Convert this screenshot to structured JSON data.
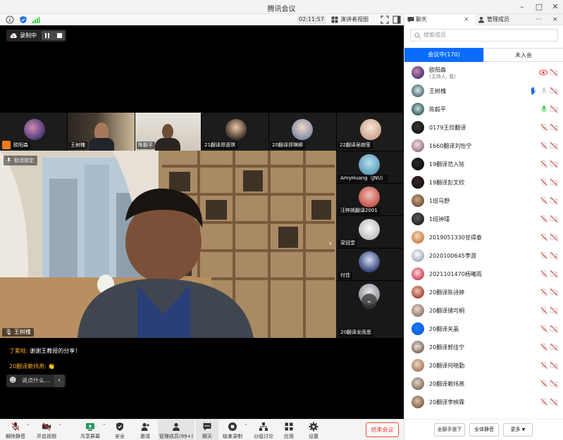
{
  "window": {
    "title": "腾讯会议"
  },
  "toolbar": {
    "timer": "02:11:57",
    "view_label": "演讲者视图"
  },
  "recording": {
    "label": "录制中"
  },
  "thumbs": [
    {
      "name": "欧阳森"
    },
    {
      "name": "王树槐"
    },
    {
      "name": "陈毅平"
    },
    {
      "name": "21翻译郑语琪"
    },
    {
      "name": "20翻译郑琳卿"
    },
    {
      "name": "22翻译吴婉莹"
    }
  ],
  "vthumbs": [
    {
      "name": "AmyHuang（JNU）"
    },
    {
      "name": "汪梓嫣翻译2001"
    },
    {
      "name": "梁冠堂"
    },
    {
      "name": "付佳"
    },
    {
      "name": "20翻译龙雨思"
    }
  ],
  "main_video": {
    "pin_label": "取消锁定",
    "speaker": "王树槐"
  },
  "chat": {
    "msg1": {
      "sender": "丁紫晗:",
      "text": "谢谢王教授的分享！"
    },
    "msg2": {
      "sender": "20翻译赖炜燕:",
      "emoji": "👏"
    },
    "placeholder": "说点什么..."
  },
  "bottom": {
    "unmute": "解除静音",
    "video": "开启视频",
    "share": "共享屏幕",
    "security": "安全",
    "invite": "邀请",
    "members": "管理成员(99+)",
    "chat": "聊天",
    "end_record": "结束录制",
    "breakout": "分组讨论",
    "apps": "应用",
    "settings": "设置",
    "end_meeting": "结束会议"
  },
  "panel": {
    "tab_chat": "聊天",
    "tab_members": "管理成员",
    "search_placeholder": "搜索成员",
    "seg_in": "会议中(170)",
    "seg_not": "未入会",
    "members": [
      {
        "name": "欧阳森",
        "sub": "(主持人, 我)"
      },
      {
        "name": "王树槐"
      },
      {
        "name": "陈毅平"
      },
      {
        "name": "0179王欣翻译"
      },
      {
        "name": "1660翻译刘怡宁"
      },
      {
        "name": "19翻译范入铱"
      },
      {
        "name": "19翻译彭文欣"
      },
      {
        "name": "1班马野"
      },
      {
        "name": "1班钟瑾"
      },
      {
        "name": "2019051330甘得泰"
      },
      {
        "name": "2020100645李游"
      },
      {
        "name": "2021101470杨曦雨"
      },
      {
        "name": "20翻译陈诗婷"
      },
      {
        "name": "20翻译储可桐"
      },
      {
        "name": "20翻译关晶"
      },
      {
        "name": "20翻译郭佳宁",
        "avatar_text": "佳宁"
      },
      {
        "name": "20翻译何晓勤"
      },
      {
        "name": "20翻译赖炜燕"
      },
      {
        "name": "20翻译李映霖"
      }
    ],
    "lower_all_hands": "全部手放下",
    "mute_all": "全体静音",
    "more": "更多"
  },
  "colors": {
    "accent": "#0a6cff",
    "danger": "#e53935",
    "mic_on": "#2ecc40"
  }
}
